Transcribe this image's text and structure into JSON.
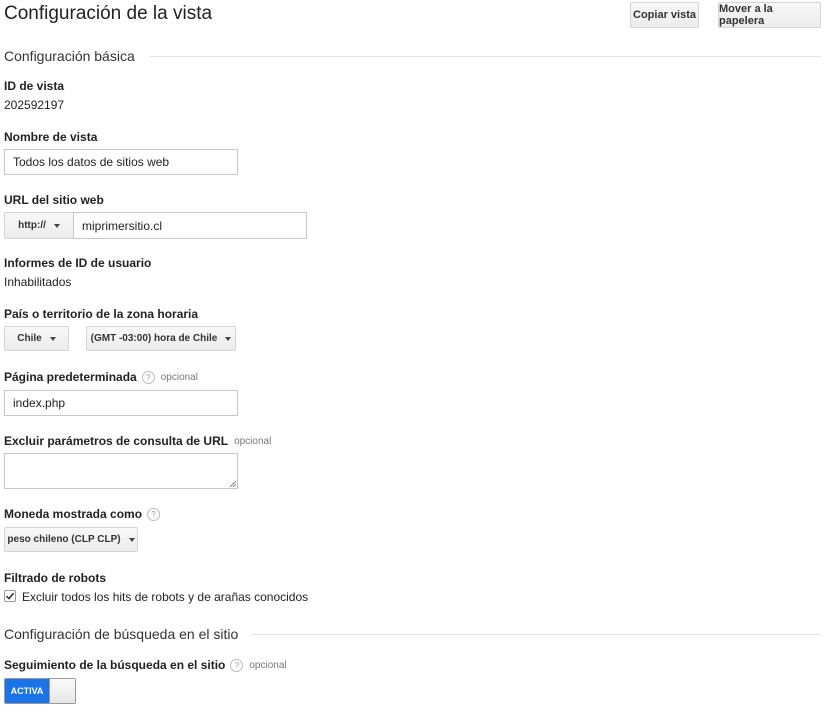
{
  "header": {
    "title": "Configuración de la vista",
    "copy_button": "Copiar vista",
    "trash_button": "Mover a la papelera"
  },
  "basic": {
    "section_title": "Configuración básica",
    "view_id_label": "ID de vista",
    "view_id_value": "202592197",
    "view_name_label": "Nombre de vista",
    "view_name_value": "Todos los datos de sitios web",
    "url_label": "URL del sitio web",
    "url_protocol": "http://",
    "url_value": "miprimersitio.cl",
    "user_id_label": "Informes de ID de usuario",
    "user_id_value": "Inhabilitados",
    "timezone_label": "País o territorio de la zona horaria",
    "country_value": "Chile",
    "timezone_value": "(GMT -03:00) hora de Chile",
    "default_page_label": "Página predeterminada",
    "default_page_optional": "opcional",
    "default_page_value": "index.php",
    "exclude_params_label": "Excluir parámetros de consulta de URL",
    "exclude_params_optional": "opcional",
    "exclude_params_value": "",
    "currency_label": "Moneda mostrada como",
    "currency_value": "peso chileno (CLP CLP)",
    "bot_filter_label": "Filtrado de robots",
    "bot_filter_checkbox_label": "Excluir todos los hits de robots y de arañas conocidos",
    "bot_filter_checked": true,
    "help_glyph": "?"
  },
  "site_search": {
    "section_title": "Configuración de búsqueda en el sitio",
    "tracking_label": "Seguimiento de la búsqueda en el sitio",
    "tracking_optional": "opcional",
    "toggle_label": "ACTIVA",
    "toggle_state": "on"
  },
  "colors": {
    "accent": "#1a73e8",
    "text": "#222222",
    "border": "#c6c6c6"
  }
}
